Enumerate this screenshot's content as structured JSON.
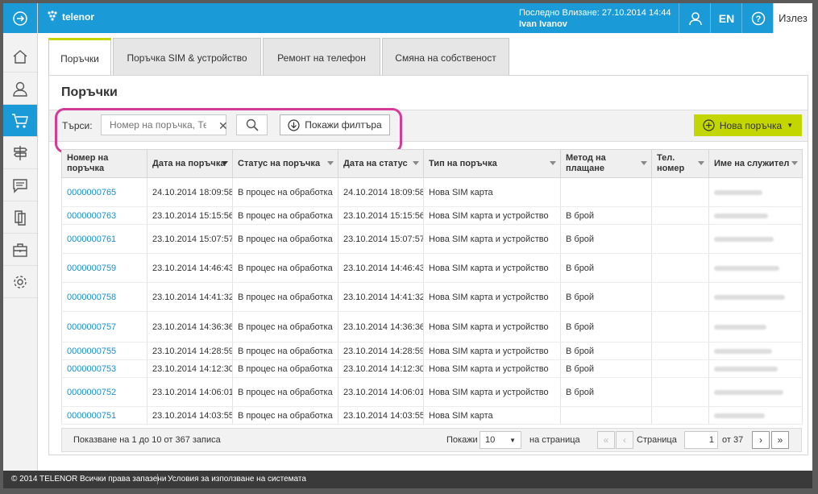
{
  "header": {
    "brand": "telenor",
    "last_login_label": "Последно Влизане: 27.10.2014 14:44",
    "user_name": "Ivan Ivanov",
    "lang": "EN",
    "logout": "Излез"
  },
  "sidebar": {
    "items": [
      {
        "icon": "home-icon"
      },
      {
        "icon": "user-icon"
      },
      {
        "icon": "cart-icon",
        "active": true
      },
      {
        "icon": "signpost-icon"
      },
      {
        "icon": "chat-icon"
      },
      {
        "icon": "documents-icon"
      },
      {
        "icon": "briefcase-icon"
      },
      {
        "icon": "gear-icon"
      }
    ]
  },
  "tabs": [
    {
      "label": "Поръчки",
      "active": true
    },
    {
      "label": "Поръчка SIM & устройство"
    },
    {
      "label": "Ремонт на телефон"
    },
    {
      "label": "Смяна на собственост"
    }
  ],
  "page": {
    "title": "Поръчки",
    "search_label": "Търси:",
    "search_placeholder": "Номер на поръчка, Тел",
    "show_filter": "Покажи филтъра",
    "new_order": "Нова поръчка"
  },
  "table": {
    "columns": [
      "Номер на поръчка",
      "Дата на поръчка",
      "Статус на поръчка",
      "Дата на статус",
      "Тип на поръчка",
      "Метод на плащане",
      "Тел. номер",
      "Име на служител"
    ],
    "rows": [
      {
        "id": "0000000765",
        "date": "24.10.2014 18:09:58",
        "status": "В процес на обработка",
        "status_date": "24.10.2014 18:09:58",
        "type": "Нова SIM карта",
        "pay": ""
      },
      {
        "id": "0000000763",
        "date": "23.10.2014 15:15:56",
        "status": "В процес на обработка",
        "status_date": "23.10.2014 15:15:56",
        "type": "Нова SIM карта и устройство",
        "pay": "В брой"
      },
      {
        "id": "0000000761",
        "date": "23.10.2014 15:07:57",
        "status": "В процес на обработка",
        "status_date": "23.10.2014 15:07:57",
        "type": "Нова SIM карта и устройство",
        "pay": "В брой"
      },
      {
        "id": "0000000759",
        "date": "23.10.2014 14:46:43",
        "status": "В процес на обработка",
        "status_date": "23.10.2014 14:46:43",
        "type": "Нова SIM карта и устройство",
        "pay": "В брой"
      },
      {
        "id": "0000000758",
        "date": "23.10.2014 14:41:32",
        "status": "В процес на обработка",
        "status_date": "23.10.2014 14:41:32",
        "type": "Нова SIM карта и устройство",
        "pay": "В брой"
      },
      {
        "id": "0000000757",
        "date": "23.10.2014 14:36:36",
        "status": "В процес на обработка",
        "status_date": "23.10.2014 14:36:36",
        "type": "Нова SIM карта и устройство",
        "pay": "В брой"
      },
      {
        "id": "0000000755",
        "date": "23.10.2014 14:28:59",
        "status": "В процес на обработка",
        "status_date": "23.10.2014 14:28:59",
        "type": "Нова SIM карта и устройство",
        "pay": "В брой"
      },
      {
        "id": "0000000753",
        "date": "23.10.2014 14:12:30",
        "status": "В процес на обработка",
        "status_date": "23.10.2014 14:12:30",
        "type": "Нова SIM карта и устройство",
        "pay": "В брой"
      },
      {
        "id": "0000000752",
        "date": "23.10.2014 14:06:01",
        "status": "В процес на обработка",
        "status_date": "23.10.2014 14:06:01",
        "type": "Нова SIM карта и устройство",
        "pay": "В брой"
      },
      {
        "id": "0000000751",
        "date": "23.10.2014 14:03:55",
        "status": "В процес на обработка",
        "status_date": "23.10.2014 14:03:55",
        "type": "Нова SIM карта",
        "pay": ""
      }
    ]
  },
  "pager": {
    "showing": "Показване на 1 до 10 от 367 записа",
    "show_label": "Покажи",
    "page_size": "10",
    "per_page": "на страница",
    "page_label": "Страница",
    "page": "1",
    "of_pages": "от 37"
  },
  "footer": {
    "copyright": "© 2014 TELENOR Всички права запазени",
    "terms": "Условия за използване на системата"
  },
  "colors": {
    "brand": "#1a9ad6",
    "accent": "#c3d600",
    "highlight": "#d43b97"
  }
}
